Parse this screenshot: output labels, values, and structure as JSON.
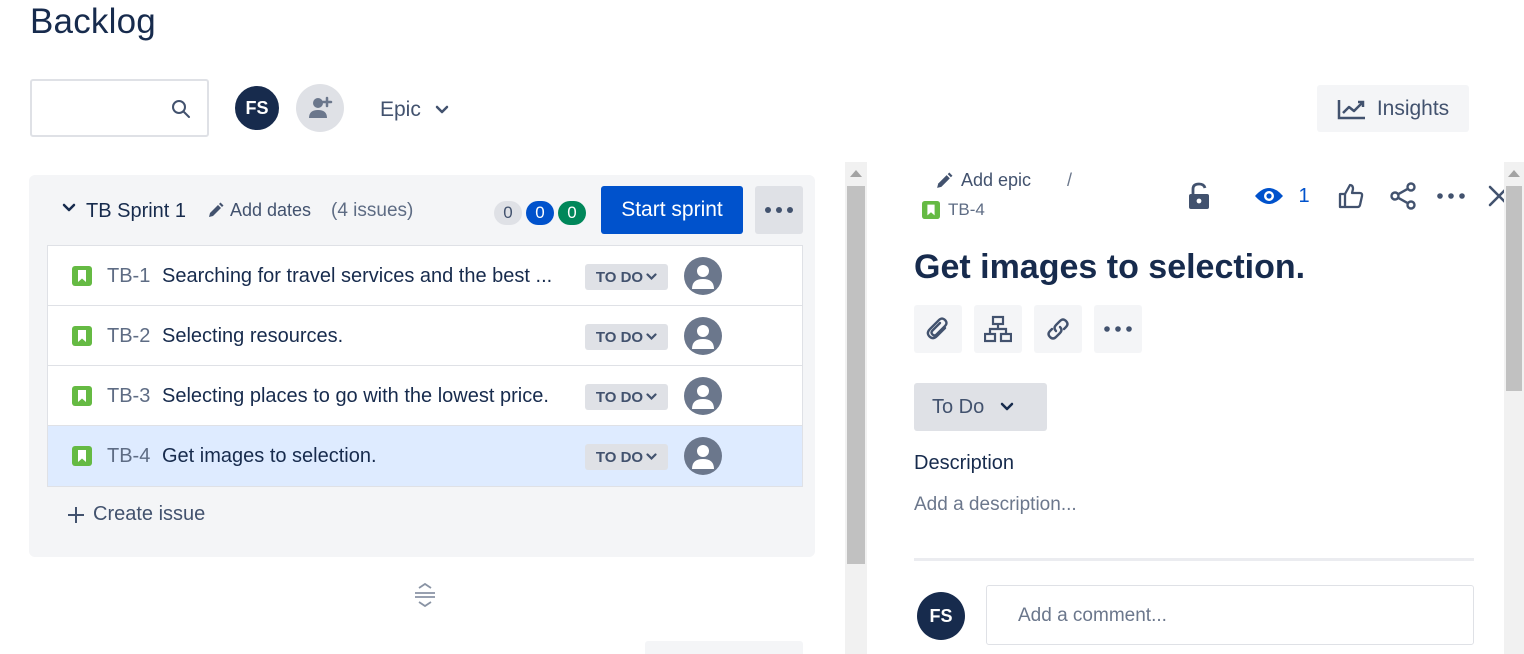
{
  "page": {
    "title": "Backlog"
  },
  "toolbar": {
    "search_value": "",
    "user_initials": "FS",
    "epic_label": "Epic",
    "insights_label": "Insights"
  },
  "sprint": {
    "name": "TB Sprint 1",
    "add_dates_label": "Add dates",
    "issue_count": "(4 issues)",
    "counts": {
      "todo": "0",
      "in_progress": "0",
      "done": "0"
    },
    "start_button": "Start sprint",
    "issues": [
      {
        "key": "TB-1",
        "summary": "Searching for travel services and the best ...",
        "status": "TO DO"
      },
      {
        "key": "TB-2",
        "summary": "Selecting resources.",
        "status": "TO DO"
      },
      {
        "key": "TB-3",
        "summary": "Selecting places to go with the lowest price.",
        "status": "TO DO"
      },
      {
        "key": "TB-4",
        "summary": "Get images to selection.",
        "status": "TO DO"
      }
    ],
    "create_issue_label": "Create issue"
  },
  "detail": {
    "add_epic_label": "Add epic",
    "breadcrumb_separator": "/",
    "issue_key": "TB-4",
    "watch_count": "1",
    "title": "Get images to selection.",
    "status": "To Do",
    "description_label": "Description",
    "description_placeholder": "Add a description...",
    "comment_user_initials": "FS",
    "comment_placeholder": "Add a comment..."
  },
  "colors": {
    "primary": "#0052cc",
    "done": "#00875a",
    "story": "#65ba43",
    "selected_row": "#deebff",
    "text": "#172b4d"
  }
}
